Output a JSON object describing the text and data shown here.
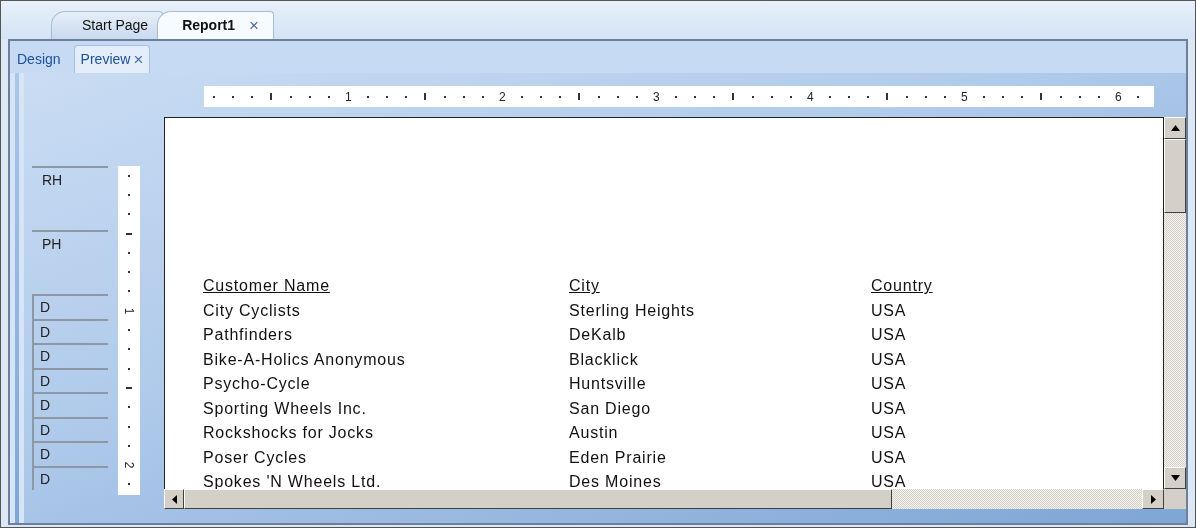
{
  "document_tabs": [
    {
      "label": "Start Page",
      "selected": false
    },
    {
      "label": "Report1",
      "selected": true,
      "close": "×"
    }
  ],
  "view_tabs": [
    {
      "label": "Design",
      "selected": false
    },
    {
      "label": "Preview",
      "selected": true,
      "close": "×"
    }
  ],
  "horizontal_ruler": {
    "numbers": [
      "1",
      "2",
      "3",
      "4",
      "5",
      "6"
    ]
  },
  "vertical_ruler": {
    "numbers": [
      "1",
      "2"
    ]
  },
  "sections": [
    {
      "label": "RH",
      "kind": "band"
    },
    {
      "label": "PH",
      "kind": "band"
    },
    {
      "label": "D",
      "kind": "detail"
    },
    {
      "label": "D",
      "kind": "detail"
    },
    {
      "label": "D",
      "kind": "detail"
    },
    {
      "label": "D",
      "kind": "detail"
    },
    {
      "label": "D",
      "kind": "detail"
    },
    {
      "label": "D",
      "kind": "detail"
    },
    {
      "label": "D",
      "kind": "detail"
    },
    {
      "label": "D",
      "kind": "detail"
    }
  ],
  "report": {
    "columns": [
      "Customer Name",
      "City",
      "Country"
    ],
    "rows": [
      [
        "City Cyclists",
        "Sterling Heights",
        "USA"
      ],
      [
        "Pathfinders",
        "DeKalb",
        "USA"
      ],
      [
        "Bike-A-Holics Anonymous",
        "Blacklick",
        "USA"
      ],
      [
        "Psycho-Cycle",
        "Huntsville",
        "USA"
      ],
      [
        "Sporting Wheels Inc.",
        "San Diego",
        "USA"
      ],
      [
        "Rockshocks for Jocks",
        "Austin",
        "USA"
      ],
      [
        "Poser Cycles",
        "Eden Prairie",
        "USA"
      ],
      [
        "Spokes 'N Wheels Ltd.",
        "Des Moines",
        "USA"
      ]
    ]
  }
}
